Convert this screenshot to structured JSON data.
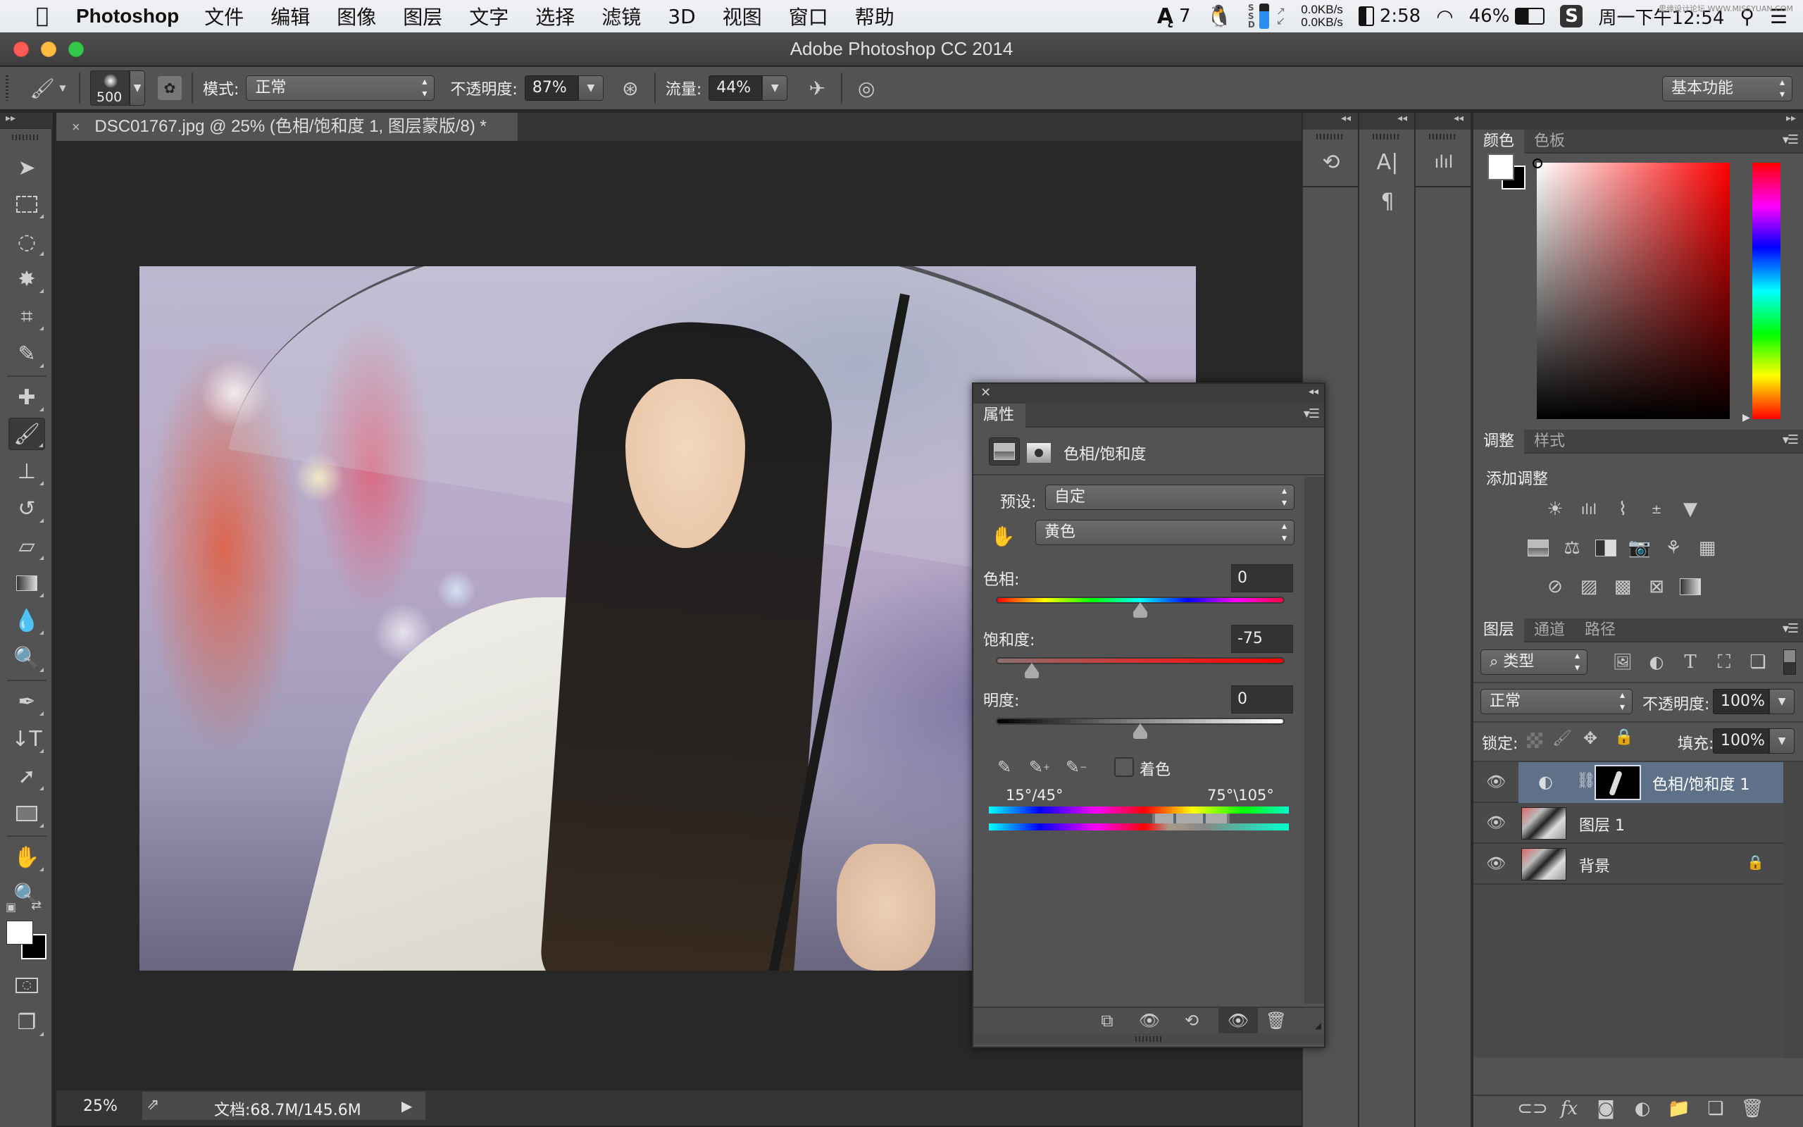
{
  "menubar": {
    "app_name": "Photoshop",
    "items": [
      "文件",
      "编辑",
      "图像",
      "图层",
      "文字",
      "选择",
      "滤镜",
      "3D",
      "视图",
      "窗口",
      "帮助"
    ],
    "status": {
      "adobe_badge": "7",
      "net_up": "0.0KB/s",
      "net_down": "0.0KB/s",
      "battery_time": "2:58",
      "battery_pct": "46%",
      "clock": "周一下午12:54",
      "watermark": "思缘设计论坛 WWW.MISSYUAN.COM"
    }
  },
  "window": {
    "title": "Adobe Photoshop CC 2014"
  },
  "options_bar": {
    "brush_size": "500",
    "mode_label": "模式:",
    "mode_value": "正常",
    "opacity_label": "不透明度:",
    "opacity_value": "87%",
    "flow_label": "流量:",
    "flow_value": "44%",
    "workspace": "基本功能"
  },
  "document": {
    "tab_title": "DSC01767.jpg @ 25% (色相/饱和度 1, 图层蒙版/8) *",
    "close_glyph": "×"
  },
  "properties": {
    "tab": "属性",
    "adjustment_title": "色相/饱和度",
    "preset_label": "预设:",
    "preset_value": "自定",
    "channel_value": "黄色",
    "hue_label": "色相:",
    "hue_value": "0",
    "hue_position": 0.5,
    "saturation_label": "饱和度:",
    "saturation_value": "-75",
    "saturation_position": 0.125,
    "lightness_label": "明度:",
    "lightness_value": "0",
    "lightness_position": 0.5,
    "colorize_label": "着色",
    "colorize_checked": false,
    "range_left": "15°/45°",
    "range_right": "75°\\105°"
  },
  "color_panel": {
    "tabs": [
      "颜色",
      "色板"
    ],
    "foreground": "#ffffff",
    "background": "#000000",
    "hue_base": "#ff0000"
  },
  "adjustments_panel": {
    "tabs": [
      "调整",
      "样式"
    ],
    "heading": "添加调整",
    "rows": [
      [
        "brightness-contrast",
        "levels",
        "curves",
        "exposure",
        "vibrance"
      ],
      [
        "hue-saturation",
        "color-balance",
        "black-white",
        "photo-filter",
        "channel-mixer",
        "color-lookup"
      ],
      [
        "invert",
        "posterize",
        "threshold",
        "selective-color",
        "gradient-map"
      ]
    ]
  },
  "layers_panel": {
    "tabs": [
      "图层",
      "通道",
      "路径"
    ],
    "filter_label": "类型",
    "blend_mode": "正常",
    "opacity_label": "不透明度:",
    "opacity_value": "100%",
    "lock_label": "锁定:",
    "fill_label": "填充:",
    "fill_value": "100%",
    "layers": [
      {
        "name": "色相/饱和度 1",
        "selected": true,
        "type": "adjustment"
      },
      {
        "name": "图层 1",
        "selected": false,
        "type": "pixel"
      },
      {
        "name": "背景",
        "selected": false,
        "type": "pixel",
        "locked": true
      }
    ]
  },
  "status_bar": {
    "zoom": "25%",
    "doc_size": "文档:68.7M/145.6M"
  }
}
